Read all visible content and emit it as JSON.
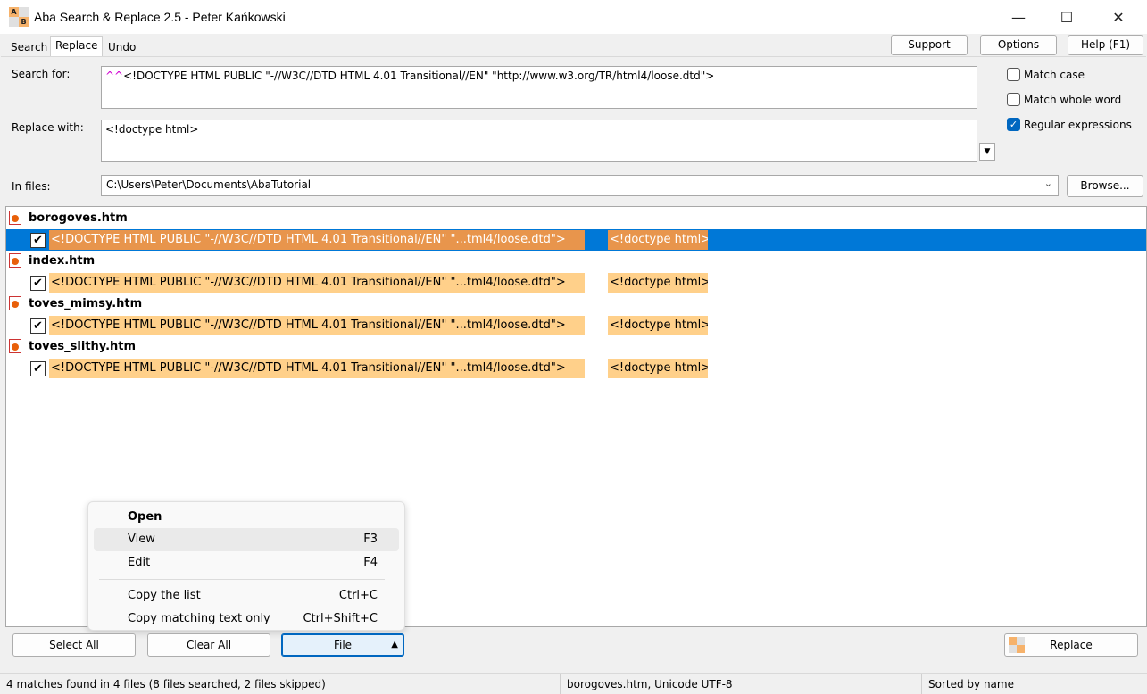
{
  "window": {
    "title": "Aba Search & Replace 2.5 - Peter Kańkowski",
    "minimize": "—",
    "maximize": "☐",
    "close": "✕"
  },
  "tabs": [
    {
      "label": "Search"
    },
    {
      "label": "Replace"
    },
    {
      "label": "Undo"
    }
  ],
  "top_buttons": {
    "support": "Support",
    "options": "Options",
    "help": "Help (F1)"
  },
  "form": {
    "search_label": "Search for:",
    "search_prefix": "^^",
    "search_value": "<!DOCTYPE HTML PUBLIC \"-//W3C//DTD HTML 4.01 Transitional//EN\" \"http://www.w3.org/TR/html4/loose.dtd\">",
    "replace_label": "Replace with:",
    "replace_value": "<!doctype html>",
    "files_label": "In files:",
    "files_value": "C:\\Users\\Peter\\Documents\\AbaTutorial",
    "browse": "Browse..."
  },
  "options": {
    "match_case": "Match case",
    "match_whole_word": "Match whole word",
    "regular_expressions": "Regular expressions"
  },
  "results": [
    {
      "file": "borogoves.htm",
      "match": "<!DOCTYPE HTML PUBLIC \"-//W3C//DTD HTML 4.01 Transitional//EN\" \"...tml4/loose.dtd\">",
      "replacement": "<!doctype html>"
    },
    {
      "file": "index.htm",
      "match": "<!DOCTYPE HTML PUBLIC \"-//W3C//DTD HTML 4.01 Transitional//EN\" \"...tml4/loose.dtd\">",
      "replacement": "<!doctype html>"
    },
    {
      "file": "toves_mimsy.htm",
      "match": "<!DOCTYPE HTML PUBLIC \"-//W3C//DTD HTML 4.01 Transitional//EN\" \"...tml4/loose.dtd\">",
      "replacement": "<!doctype html>"
    },
    {
      "file": "toves_slithy.htm",
      "match": "<!DOCTYPE HTML PUBLIC \"-//W3C//DTD HTML 4.01 Transitional//EN\" \"...tml4/loose.dtd\">",
      "replacement": "<!doctype html>"
    }
  ],
  "context_menu": {
    "open": "Open",
    "view": "View",
    "view_key": "F3",
    "edit": "Edit",
    "edit_key": "F4",
    "copy_list": "Copy the list",
    "copy_list_key": "Ctrl+C",
    "copy_matching": "Copy matching text only",
    "copy_matching_key": "Ctrl+Shift+C"
  },
  "bottom": {
    "select_all": "Select All",
    "clear_all": "Clear All",
    "file": "File",
    "replace": "Replace"
  },
  "status": {
    "matches": "4 matches found in 4 files (8 files searched, 2 files skipped)",
    "encoding": "borogoves.htm, Unicode UTF-8",
    "sort": "Sorted by name"
  },
  "colors": {
    "selection": "#0078d7",
    "highlight": "#ffd08a",
    "accent": "#0067c0"
  }
}
